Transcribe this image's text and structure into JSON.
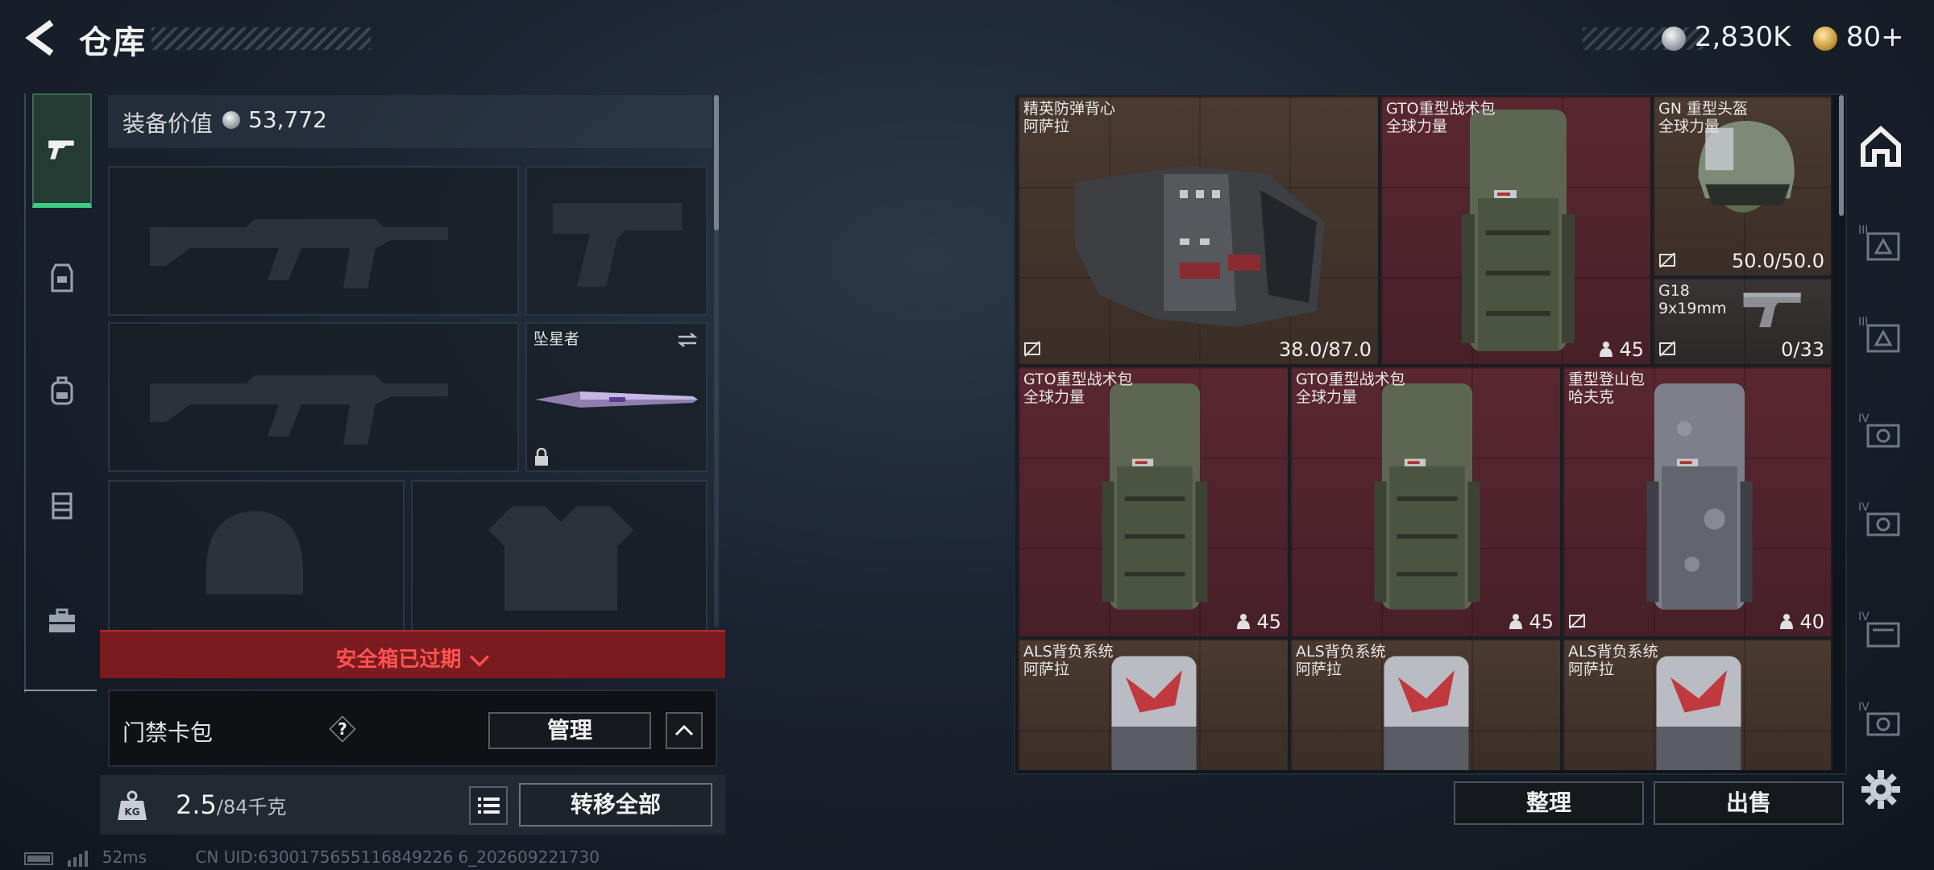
{
  "header": {
    "title": "仓库",
    "currencies": [
      {
        "icon": "silver-coin-icon",
        "value": "2,830K"
      },
      {
        "icon": "gold-coin-icon",
        "value": "80+"
      }
    ]
  },
  "left_tabs": [
    "pistol-icon",
    "armor-vest-icon",
    "backpack-icon",
    "rig-icon",
    "case-icon"
  ],
  "equipment": {
    "value_label": "装备价值",
    "value": "53,772",
    "melee_name": "坠星者"
  },
  "safe_box": {
    "label": "安全箱已过期"
  },
  "keycard": {
    "label": "门禁卡包",
    "help": "?",
    "manage": "管理"
  },
  "bottom_left": {
    "weight": "2.5",
    "weight_capacity": "/84千克",
    "transfer_all": "转移全部"
  },
  "status": {
    "ping": "52ms",
    "uid": "CN UID:6300175655116849226 6_202609221730"
  },
  "stash": {
    "items": [
      {
        "name": "精英防弹背心",
        "brand": "阿萨拉",
        "value": "38.0/87.0",
        "color": "brown"
      },
      {
        "name": "GTO重型战术包",
        "brand": "全球力量",
        "value": "45",
        "color": "red"
      },
      {
        "name": "GN 重型头盔",
        "brand": "全球力量",
        "value": "50.0/50.0",
        "color": "brown"
      },
      {
        "name": "G18",
        "brand": "9x19mm",
        "value": "0/33",
        "color": "dark"
      },
      {
        "name": "GTO重型战术包",
        "brand": "全球力量",
        "value": "45",
        "color": "red"
      },
      {
        "name": "GTO重型战术包",
        "brand": "全球力量",
        "value": "45",
        "color": "red"
      },
      {
        "name": "重型登山包",
        "brand": "哈夫克",
        "value": "40",
        "color": "red"
      },
      {
        "name": "ALS背负系统",
        "brand": "阿萨拉",
        "value": "",
        "color": "brown"
      },
      {
        "name": "ALS背负系统",
        "brand": "阿萨拉",
        "value": "",
        "color": "brown"
      },
      {
        "name": "ALS背负系统",
        "brand": "阿萨拉",
        "value": "",
        "color": "brown"
      }
    ],
    "sort": "整理",
    "sell": "出售"
  },
  "right_tabs": [
    "stash-icon",
    "III-armor-case-icon",
    "III-armor-case-icon",
    "IV-camera-case-icon",
    "IV-camera-case-icon",
    "IV-case-icon",
    "IV-camera-case-icon"
  ]
}
